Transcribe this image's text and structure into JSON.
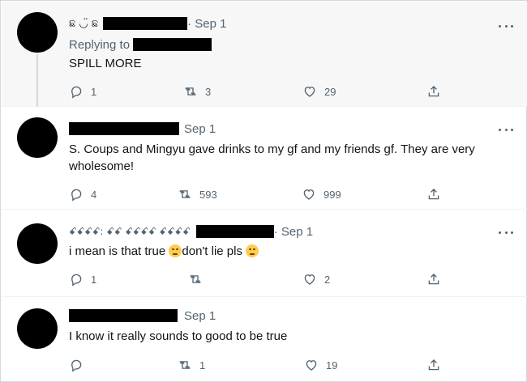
{
  "tweets": [
    {
      "display_name": "ଛ ◡̈ ଛ",
      "date": "· Sep 1",
      "replying_to_label": "Replying to",
      "text": "SPILL MORE",
      "replies": "1",
      "retweets": "3",
      "likes": "29"
    },
    {
      "date": "Sep 1",
      "text": "S. Coups and Mingyu gave drinks to my gf and my friends gf. They are very wholesome!",
      "replies": "4",
      "retweets": "593",
      "likes": "999"
    },
    {
      "display_name": "ꗃꗃꗃꗃ: ꗃꗃ ꗃꗃꗃꗃ ꗃꗃꗃꗃ",
      "date": "· Sep 1",
      "text_part1": "i mean is that true ",
      "text_part2": "don't  lie pls ",
      "replies": "1",
      "retweets": "",
      "likes": "2"
    },
    {
      "date": "Sep 1",
      "text": "I know it really sounds to good to be true",
      "replies": "",
      "retweets": "1",
      "likes": "19"
    }
  ],
  "icons": {
    "reply": "reply-icon",
    "retweet": "retweet-icon",
    "like": "heart-icon",
    "share": "share-icon",
    "more": "more-icon"
  },
  "colors": {
    "secondary_text": "#536471",
    "highlight_bg": "#f7f7f7",
    "thread_line": "#cfd9de"
  }
}
